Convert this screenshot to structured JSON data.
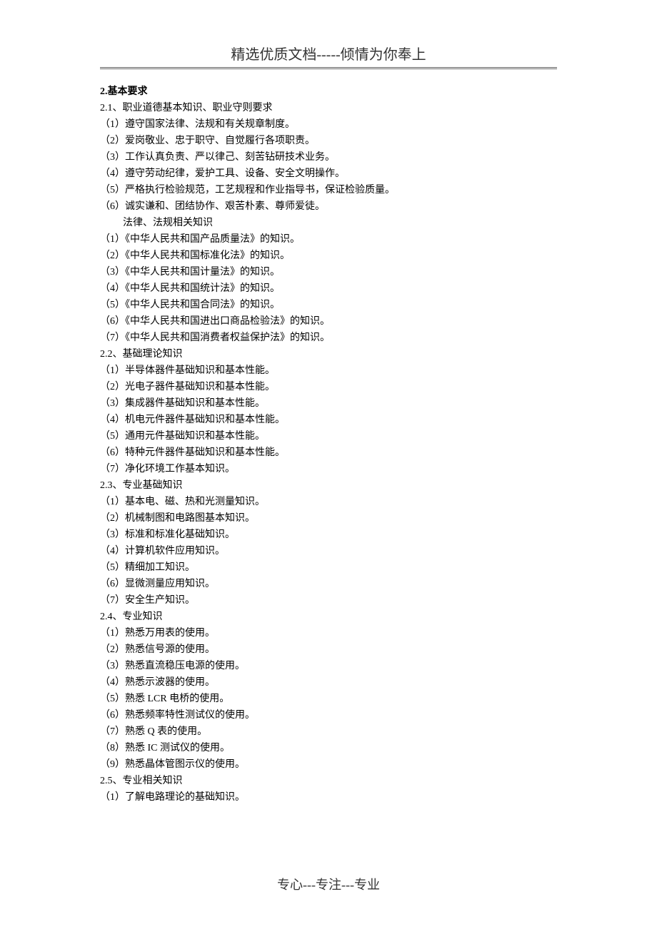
{
  "header": "精选优质文档-----倾情为你奉上",
  "footer": "专心---专注---专业",
  "sections": {
    "s2": {
      "title": "2.基本要求",
      "s2_1": {
        "title": "2.1、职业道德基本知识、职业守则要求",
        "items": [
          "（1）遵守国家法律、法规和有关规章制度。",
          "（2）爱岗敬业、忠于职守、自觉履行各项职责。",
          "（3）工作认真负责、严以律己、刻苦钻研技术业务。",
          "（4）遵守劳动纪律，爱护工具、设备、安全文明操作。",
          "（5）严格执行检验规范，工艺规程和作业指导书，保证检验质量。",
          "（6）诚实谦和、团结协作、艰苦朴素、尊师爱徒。"
        ],
        "sub_label": "法律、法规相关知识",
        "laws": [
          "（1）《中华人民共和国产品质量法》的知识。",
          "（2）《中华人民共和国标准化法》的知识。",
          "（3）《中华人民共和国计量法》的知识。",
          "（4）《中华人民共和国统计法》的知识。",
          "（5）《中华人民共和国合同法》的知识。",
          "（6）《中华人民共和国进出口商品检验法》的知识。",
          "（7）《中华人民共和国消费者权益保护法》的知识。"
        ]
      },
      "s2_2": {
        "title": "2.2、基础理论知识",
        "items": [
          "（1）半导体器件基础知识和基本性能。",
          "（2）光电子器件基础知识和基本性能。",
          "（3）集成器件基础知识和基本性能。",
          "（4）机电元件器件基础知识和基本性能。",
          "（5）通用元件基础知识和基本性能。",
          "（6）特种元件器件基础知识和基本性能。",
          "（7）净化环境工作基本知识。"
        ]
      },
      "s2_3": {
        "title": "2.3、专业基础知识",
        "items": [
          "（1）基本电、磁、热和光测量知识。",
          "（2）机械制图和电路图基本知识。",
          "（3）标准和标准化基础知识。",
          "（4）计算机软件应用知识。",
          "（5）精细加工知识。",
          "（6）显微测量应用知识。",
          "（7）安全生产知识。"
        ]
      },
      "s2_4": {
        "title": "2.4、专业知识",
        "items": [
          "（1）熟悉万用表的使用。",
          "（2）熟悉信号源的使用。",
          "（3）熟悉直流稳压电源的使用。",
          "（4）熟悉示波器的使用。",
          "（5）熟悉 LCR 电桥的使用。",
          "（6）熟悉频率特性测试仪的使用。",
          "（7）熟悉 Q 表的使用。",
          "（8）熟悉 IC 测试仪的使用。",
          "（9）熟悉晶体管图示仪的使用。"
        ]
      },
      "s2_5": {
        "title": "2.5、专业相关知识",
        "items": [
          "（1）了解电路理论的基础知识。"
        ]
      }
    }
  }
}
